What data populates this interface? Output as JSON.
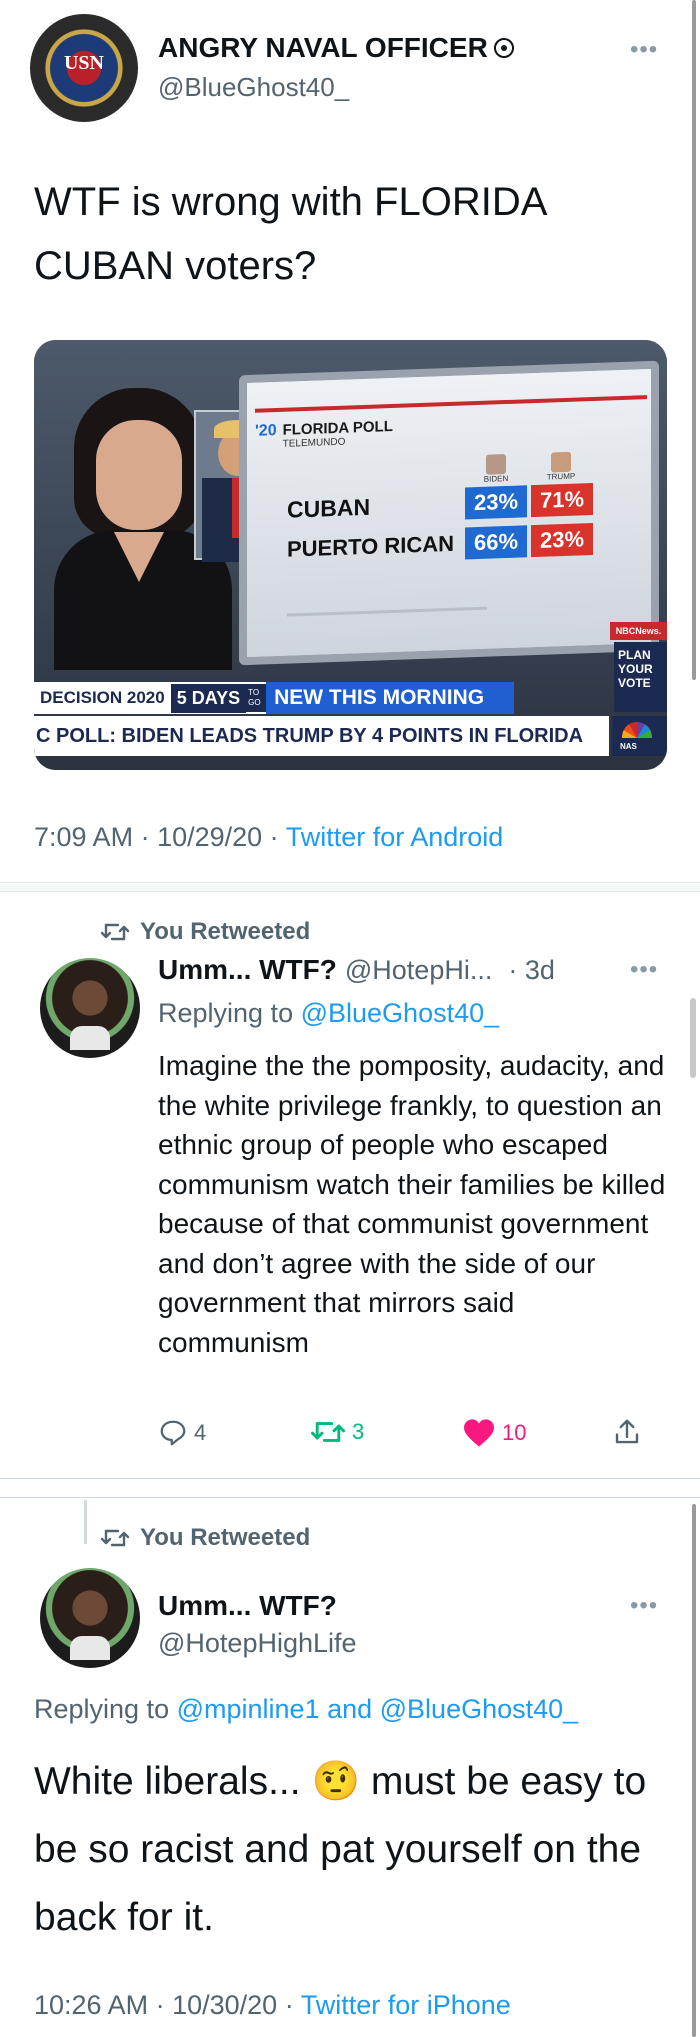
{
  "tweet1": {
    "display_name": "ANGRY NAVAL OFFICER",
    "verified_icon": "verified-badge-icon",
    "handle": "@BlueGhost40_",
    "text": "WTF is wrong with FLORIDA CUBAN voters?",
    "media": {
      "poll_title": "FLORIDA POLL",
      "poll_source": "TELEMUNDO",
      "poll_year_tag": "'20",
      "col_biden": "BIDEN",
      "col_trump": "TRUMP",
      "rows": [
        {
          "label": "CUBAN",
          "biden": "23%",
          "trump": "71%"
        },
        {
          "label": "PUERTO RICAN",
          "biden": "66%",
          "trump": "23%"
        }
      ],
      "network_tag": "NBCNews.",
      "side_promo": "PLAN YOUR VOTE",
      "banner_left": "DECISION 2020",
      "banner_days": "5 DAYS",
      "banner_togo": "TO GO",
      "banner_right": "NEW THIS MORNING",
      "ticker": "C POLL: BIDEN LEADS TRUMP BY 4 POINTS IN FLORIDA",
      "small_corner": "NAS"
    },
    "time": "7:09 AM",
    "date": "10/29/20",
    "client": "Twitter for Android"
  },
  "tweet2": {
    "retweet_label": "You Retweeted",
    "display_name": "Umm... WTF?",
    "handle": "@HotepHi...",
    "age": "· 3d",
    "replying_prefix": "Replying to",
    "replying_to": "@BlueGhost40_",
    "text": "Imagine the the pomposity, audacity, and the white privilege frankly, to question an ethnic group of people who escaped communism watch their families be killed because of that communist government and don’t agree with the side of our government that mirrors said communism",
    "replies": "4",
    "retweets": "3",
    "likes": "10"
  },
  "tweet3": {
    "retweet_label": "You Retweeted",
    "display_name": "Umm... WTF?",
    "handle": "@HotepHighLife",
    "replying_prefix": "Replying to",
    "replying_to": "@mpinline1 and @BlueGhost40_",
    "text_before": "White liberals...",
    "emoji": "🤨",
    "text_after": "must be easy to be so racist and pat yourself on the back for it.",
    "time": "10:26 AM",
    "date": "10/30/20",
    "client": "Twitter for iPhone"
  },
  "colors": {
    "accent": "#1d9bf0",
    "like": "#f91880",
    "retweet": "#00ba7c",
    "biden_cell": "#1f6ad1",
    "trump_cell": "#d9342b"
  }
}
